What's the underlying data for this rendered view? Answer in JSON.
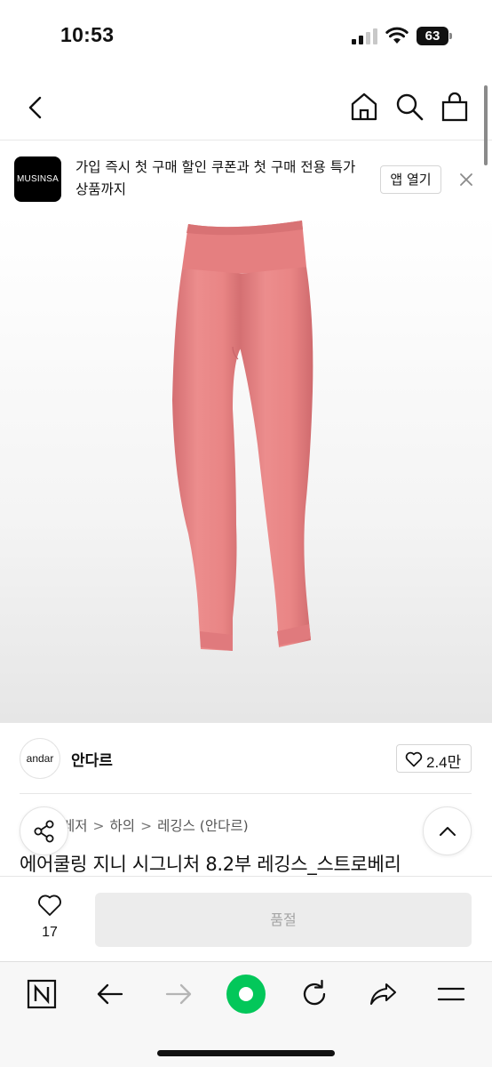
{
  "status_bar": {
    "time": "10:53",
    "battery": "63"
  },
  "header": {
    "icons": [
      "chevron-left-icon",
      "home-icon",
      "search-icon",
      "shopping-bag-icon"
    ]
  },
  "app_banner": {
    "logo_text": "MUSINSA",
    "message": "가입 즉시 첫 구매 할인 쿠폰과 첫 구매 전용 특가 상품까지",
    "open_app_label": "앱 열기"
  },
  "product": {
    "image_icon": "pink-leggings",
    "image_color": "#e98585",
    "brand": {
      "logo_text": "andar",
      "name": "안다르"
    },
    "likes_label": "2.4만",
    "breadcrumb": [
      "레저",
      "하의",
      "레깅스 (안다르)"
    ],
    "breadcrumb_separator": ">",
    "title": "에어쿨링 지니 시그니처 8.2부 레깅스_스트로베리"
  },
  "purchase_bar": {
    "wish_count": "17",
    "soldout_label": "품절"
  },
  "browser_toolbar": {
    "accent": "#03c75a",
    "icons": [
      "naver-n-icon",
      "back-arrow-icon",
      "forward-arrow-icon",
      "green-dot-icon",
      "reload-icon",
      "share-icon",
      "menu-icon"
    ]
  }
}
